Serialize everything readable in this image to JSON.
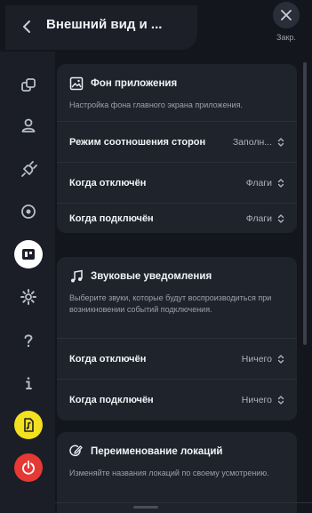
{
  "header": {
    "title": "Внешний вид и ...",
    "close_label": "Закр."
  },
  "sidebar": {
    "items": [
      {
        "icon": "layers-icon",
        "active": false
      },
      {
        "icon": "user-icon",
        "active": false
      },
      {
        "icon": "plug-icon",
        "active": false
      },
      {
        "icon": "target-icon",
        "active": false
      },
      {
        "icon": "appearance-icon",
        "active": true
      },
      {
        "icon": "gear-icon",
        "active": false
      },
      {
        "icon": "help-icon",
        "active": false
      },
      {
        "icon": "info-icon",
        "active": false
      },
      {
        "icon": "music-file-icon",
        "color": "#f3e01f"
      },
      {
        "icon": "power-icon",
        "color": "#e53935"
      }
    ]
  },
  "background_card": {
    "title": "Фон приложения",
    "description": "Настройка фона главного экрана приложения.",
    "rows": [
      {
        "label": "Режим соотношения сторон",
        "value": "Заполн..."
      },
      {
        "label": "Когда отключён",
        "value": "Флаги"
      },
      {
        "label": "Когда подключён",
        "value": "Флаги"
      }
    ]
  },
  "sound_card": {
    "title": "Звуковые уведомления",
    "description": "Выберите звуки, которые будут воспроизводиться при возникновении событий подключения.",
    "rows": [
      {
        "label": "Когда отключён",
        "value": "Ничего"
      },
      {
        "label": "Когда подключён",
        "value": "Ничего"
      }
    ]
  },
  "rename_card": {
    "title": "Переименование локаций",
    "description": "Изменяйте названия локаций по своему усмотрению."
  }
}
